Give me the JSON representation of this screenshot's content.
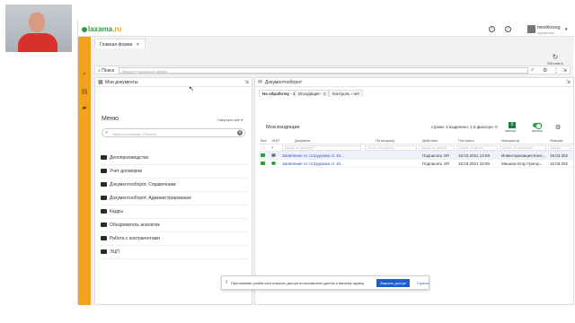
{
  "window": {
    "tab_label": "Главная форма"
  },
  "brand": {
    "name": "laxama",
    "suffix": ".ru"
  },
  "user": {
    "name": "meshkoveg",
    "role": "Бухгалтер"
  },
  "refresh": {
    "label": "Обновить"
  },
  "search": {
    "label": "Поиск",
    "placeholder": "Введите поисковый запрос"
  },
  "left_panel": {
    "title": "Мои документы",
    "menu_title": "Меню",
    "collapse_label": "Свернуть все",
    "search_placeholder": "Ввести название Объекта",
    "folders": [
      "Делопроизводство",
      "Учет договоров",
      "Документооборот. Справочники",
      "Документооборот. Администрирование",
      "Кадры",
      "Обозреватель аналитик",
      "Работа с контрагентами",
      "ЭЦП"
    ]
  },
  "right_panel": {
    "title": "Документооборот",
    "tabs": [
      "На обработку - 2",
      "Исходящие - 3",
      "Контроль - нет"
    ],
    "inbox_title": "Мои входящие",
    "stats": "строки: 2  выделено: 1  в фильтре: 0",
    "export_label": "экспорт",
    "filter_label": "фильтр",
    "columns": [
      "Все",
      "ЭЦП",
      "Документ",
      "По вопросу",
      "Действие",
      "Поступил",
      "Инициатор",
      "Инициа"
    ],
    "filter_placeholders": [
      "Искать по документ",
      "Искать по вопросу",
      "Искать по действ",
      "Искать по датам",
      "Искать по инициатор",
      "Искать"
    ],
    "rows": [
      {
        "document": "Заявление от сотрудника от 15...",
        "action": "Подписать ЭП",
        "received": "16.03.2021 14:58",
        "initiator": "Инвентаризация Конс...",
        "initiated": "16.03.202"
      },
      {
        "document": "Заявление от сотрудника от 15...",
        "action": "Подписать ЭП",
        "received": "16.03.2021 15:00",
        "initiator": "Мешков Егор Григор...",
        "initiated": "16.03.202"
      }
    ]
  },
  "toast": {
    "text": "Приложение youfile.com открыло доступ пользователю доступ к вашему экрану",
    "primary": "Закрыть доступ",
    "secondary": "Скрыть"
  },
  "colors": {
    "accent": "#f3a21e",
    "brand": "#2e9e46",
    "link": "#3a4fb5",
    "button": "#1f5fcc"
  }
}
